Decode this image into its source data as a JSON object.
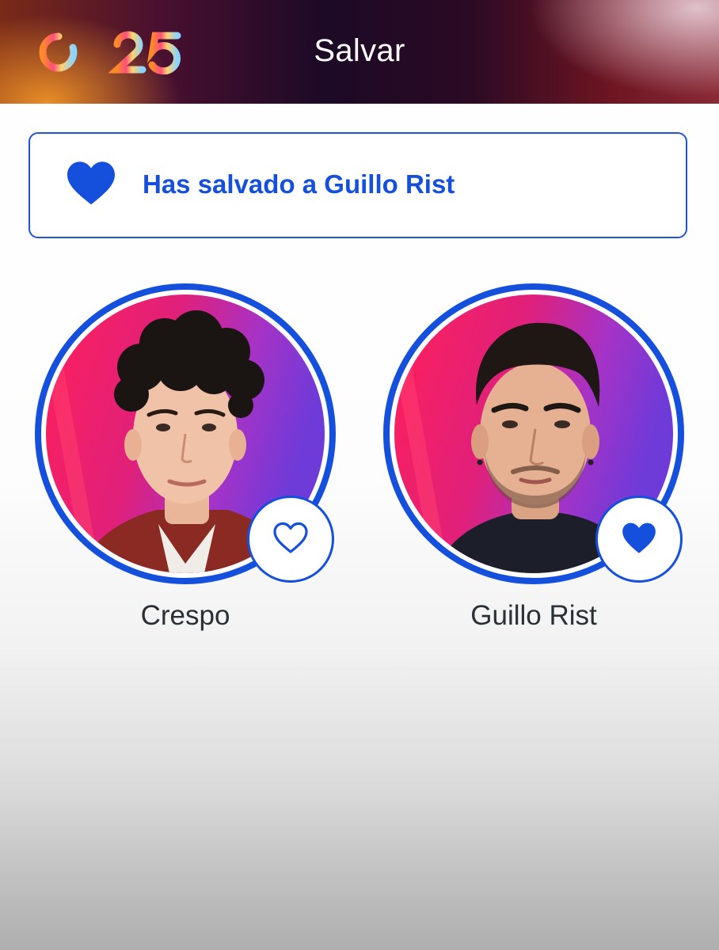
{
  "header": {
    "logo_text": "OT25",
    "title": "Salvar",
    "colors": {
      "gradient_left": "#7a2a18",
      "gradient_mid": "#1c0a26",
      "gradient_right": "#8a2a36"
    }
  },
  "banner": {
    "icon": "heart-filled-icon",
    "message": "Has salvado a Guillo Rist",
    "color": "#1450dc"
  },
  "contestants": [
    {
      "name": "Crespo",
      "avatar": "contestant-photo",
      "like_icon": "heart-outline-icon",
      "saved": false
    },
    {
      "name": "Guillo Rist",
      "avatar": "contestant-photo",
      "like_icon": "heart-filled-icon",
      "saved": true
    }
  ],
  "accent_color": "#1450dc"
}
